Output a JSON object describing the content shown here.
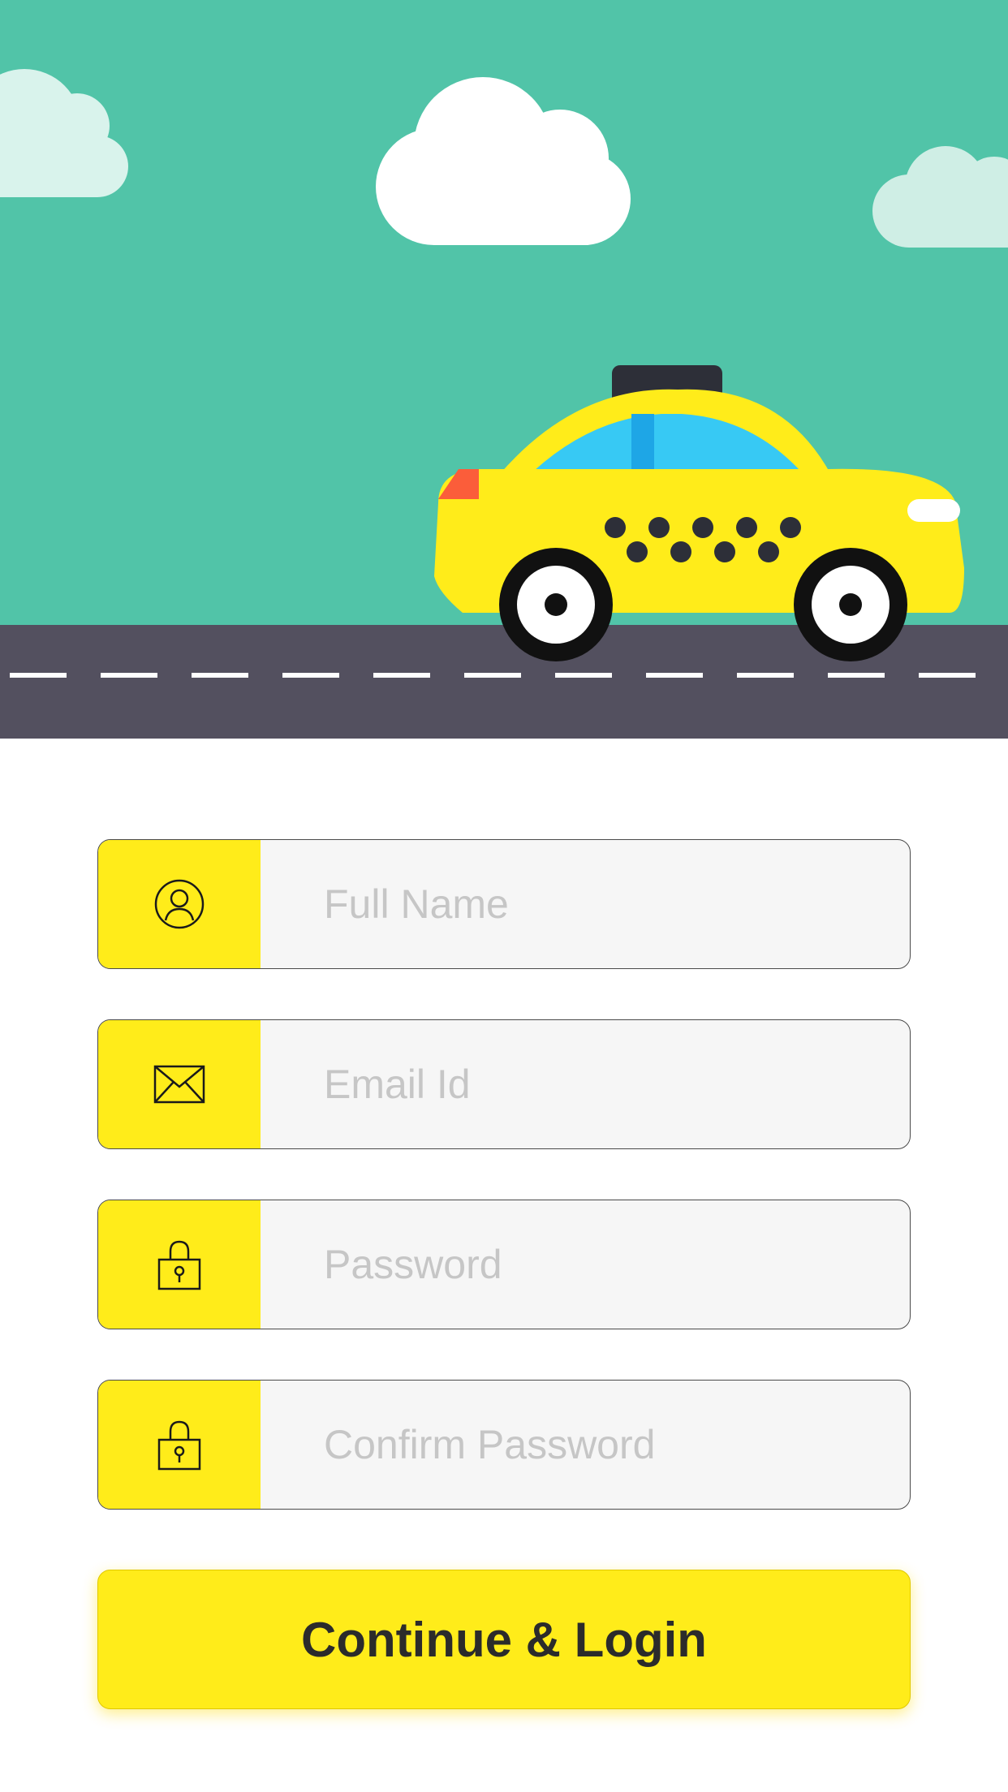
{
  "form": {
    "fields": [
      {
        "placeholder": "Full Name",
        "icon": "user-icon",
        "type": "text"
      },
      {
        "placeholder": "Email Id",
        "icon": "envelope-icon",
        "type": "email"
      },
      {
        "placeholder": "Password",
        "icon": "lock-icon",
        "type": "password"
      },
      {
        "placeholder": "Confirm Password",
        "icon": "lock-icon",
        "type": "password"
      }
    ]
  },
  "cta": {
    "label": "Continue & Login"
  },
  "colors": {
    "sky": "#51c4a8",
    "road": "#53505f",
    "accent_yellow": "#ffec1a",
    "field_bg": "#f6f6f6",
    "placeholder": "#c6c6c6"
  }
}
